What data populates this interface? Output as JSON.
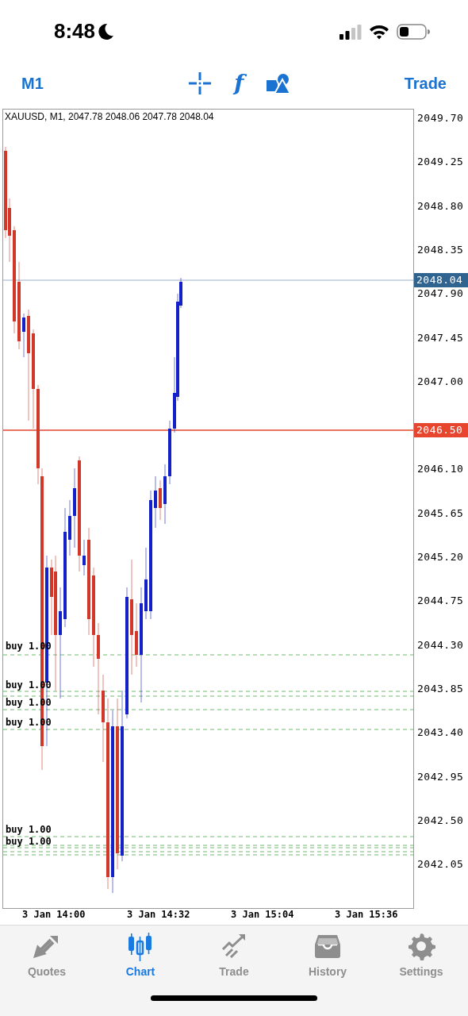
{
  "status_bar": {
    "time": "8:48"
  },
  "toolbar": {
    "timeframe": "M1",
    "indicators": "f",
    "trade": "Trade"
  },
  "chart": {
    "title": "XAUUSD, M1, 2047.78 2048.06 2047.78 2048.04",
    "price_ticks": [
      "2049.70",
      "2049.25",
      "2048.80",
      "2048.35",
      "2047.90",
      "2047.45",
      "2047.00",
      "2046.10",
      "2045.65",
      "2045.20",
      "2044.75",
      "2044.30",
      "2043.85",
      "2043.40",
      "2042.95",
      "2042.50",
      "2042.05"
    ],
    "bid_badge": "2048.04",
    "level_badge": "2046.50",
    "time_ticks": [
      "3 Jan 14:00",
      "3 Jan 14:32",
      "3 Jan 15:04",
      "3 Jan 15:36"
    ],
    "orders": [
      {
        "label": "buy 1.00"
      },
      {
        "label": "buy 1.00"
      },
      {
        "label": "buy 1.00"
      },
      {
        "label": "buy 1.00"
      },
      {
        "label": "buy 1.00"
      },
      {
        "label": "buy 1.00"
      }
    ]
  },
  "tabs": [
    {
      "label": "Quotes",
      "selected": false
    },
    {
      "label": "Chart",
      "selected": true
    },
    {
      "label": "Trade",
      "selected": false
    },
    {
      "label": "History",
      "selected": false
    },
    {
      "label": "Settings",
      "selected": false
    }
  ]
}
